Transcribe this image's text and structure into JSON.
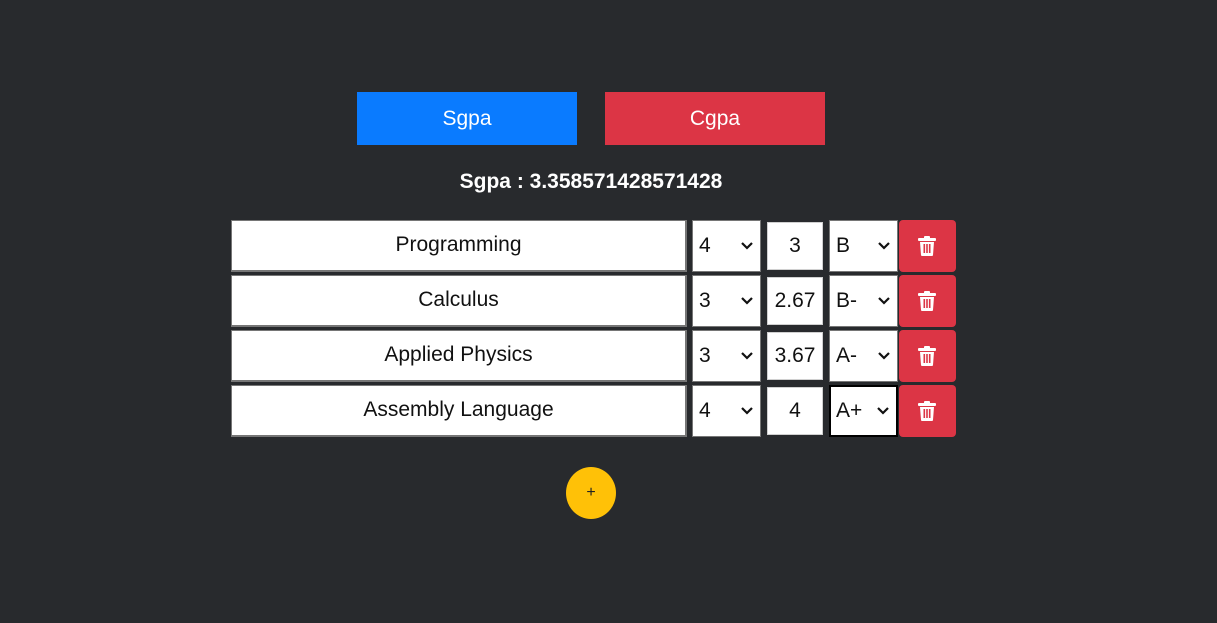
{
  "tabs": {
    "sgpa_label": "Sgpa",
    "cgpa_label": "Cgpa",
    "sgpa_color": "#0a7bff",
    "cgpa_color": "#dc3545"
  },
  "result": {
    "text": "Sgpa : 3.358571428571428"
  },
  "courses": [
    {
      "subject": "Programming",
      "credits": "4",
      "points": "3",
      "grade": "B"
    },
    {
      "subject": "Calculus",
      "credits": "3",
      "points": "2.67",
      "grade": "B-"
    },
    {
      "subject": "Applied Physics",
      "credits": "3",
      "points": "3.67",
      "grade": "A-"
    },
    {
      "subject": "Assembly Language",
      "credits": "4",
      "points": "4",
      "grade": "A+"
    }
  ],
  "icons": {
    "delete": "trash-icon",
    "dropdown": "chevron-down-icon"
  },
  "add_button": {
    "label": "+",
    "color": "#ffc107"
  }
}
